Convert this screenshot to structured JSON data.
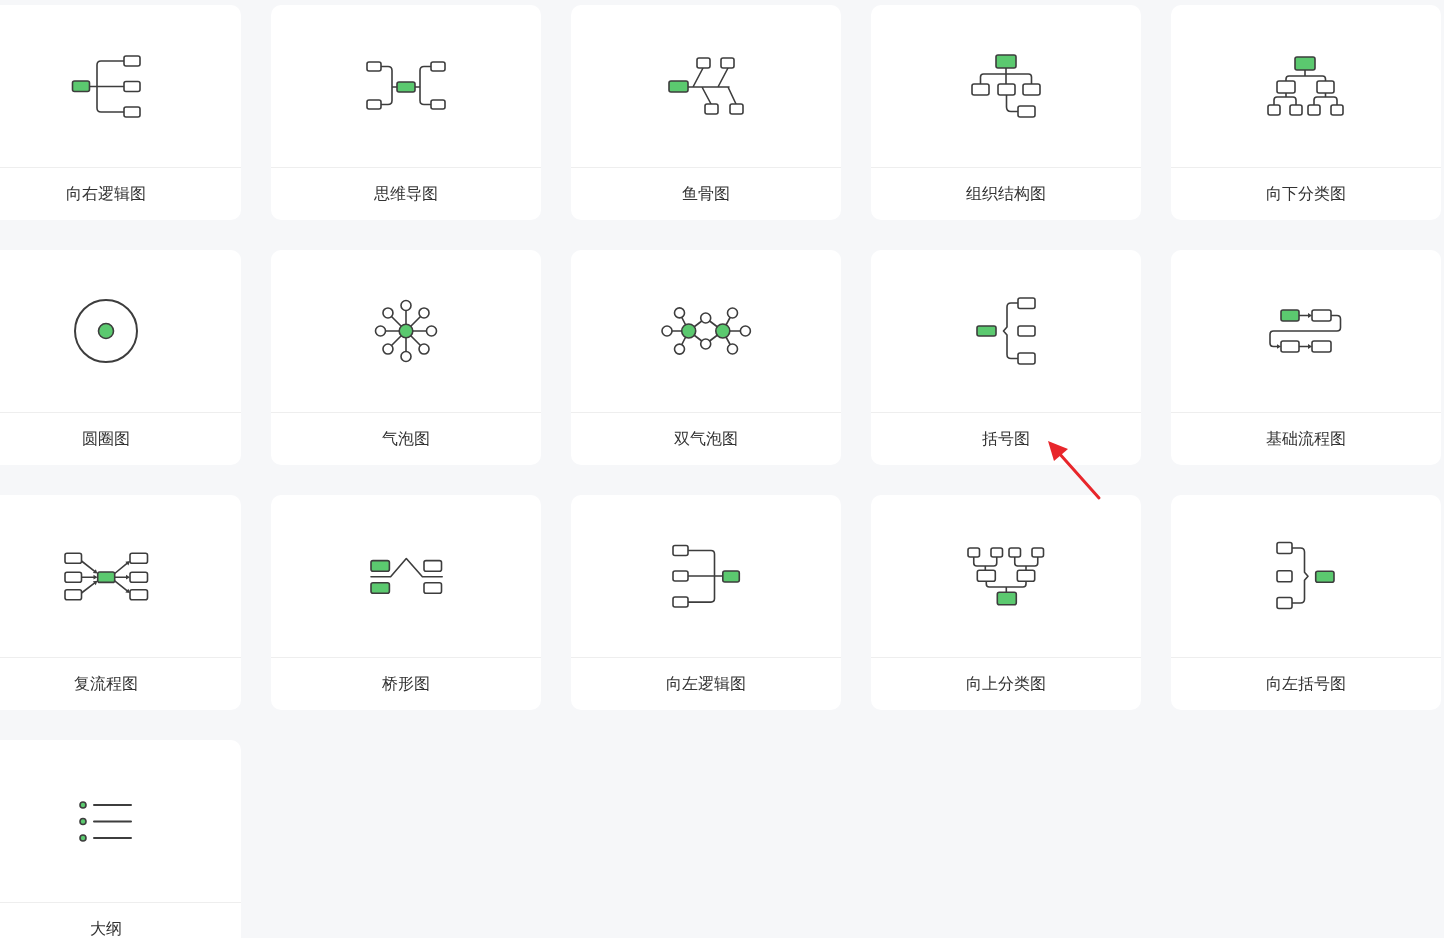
{
  "templates": [
    {
      "label": "向右逻辑图",
      "kind": "logicRight",
      "marked": false
    },
    {
      "label": "思维导图",
      "kind": "mindMap",
      "marked": false
    },
    {
      "label": "鱼骨图",
      "kind": "fishbone",
      "marked": false
    },
    {
      "label": "组织结构图",
      "kind": "orgChart",
      "marked": false
    },
    {
      "label": "向下分类图",
      "kind": "treeDown",
      "marked": false
    },
    {
      "label": "圆圈图",
      "kind": "circle",
      "marked": false
    },
    {
      "label": "气泡图",
      "kind": "bubble",
      "marked": false
    },
    {
      "label": "双气泡图",
      "kind": "doubleBubble",
      "marked": false
    },
    {
      "label": "括号图",
      "kind": "brace",
      "marked": true
    },
    {
      "label": "基础流程图",
      "kind": "flow",
      "marked": false
    },
    {
      "label": "复流程图",
      "kind": "multiFlow",
      "marked": false
    },
    {
      "label": "桥形图",
      "kind": "bridge",
      "marked": false
    },
    {
      "label": "向左逻辑图",
      "kind": "logicLeft",
      "marked": false
    },
    {
      "label": "向上分类图",
      "kind": "treeUp",
      "marked": false
    },
    {
      "label": "向左括号图",
      "kind": "braceLeft",
      "marked": false
    },
    {
      "label": "大纲",
      "kind": "outline",
      "marked": false
    }
  ]
}
